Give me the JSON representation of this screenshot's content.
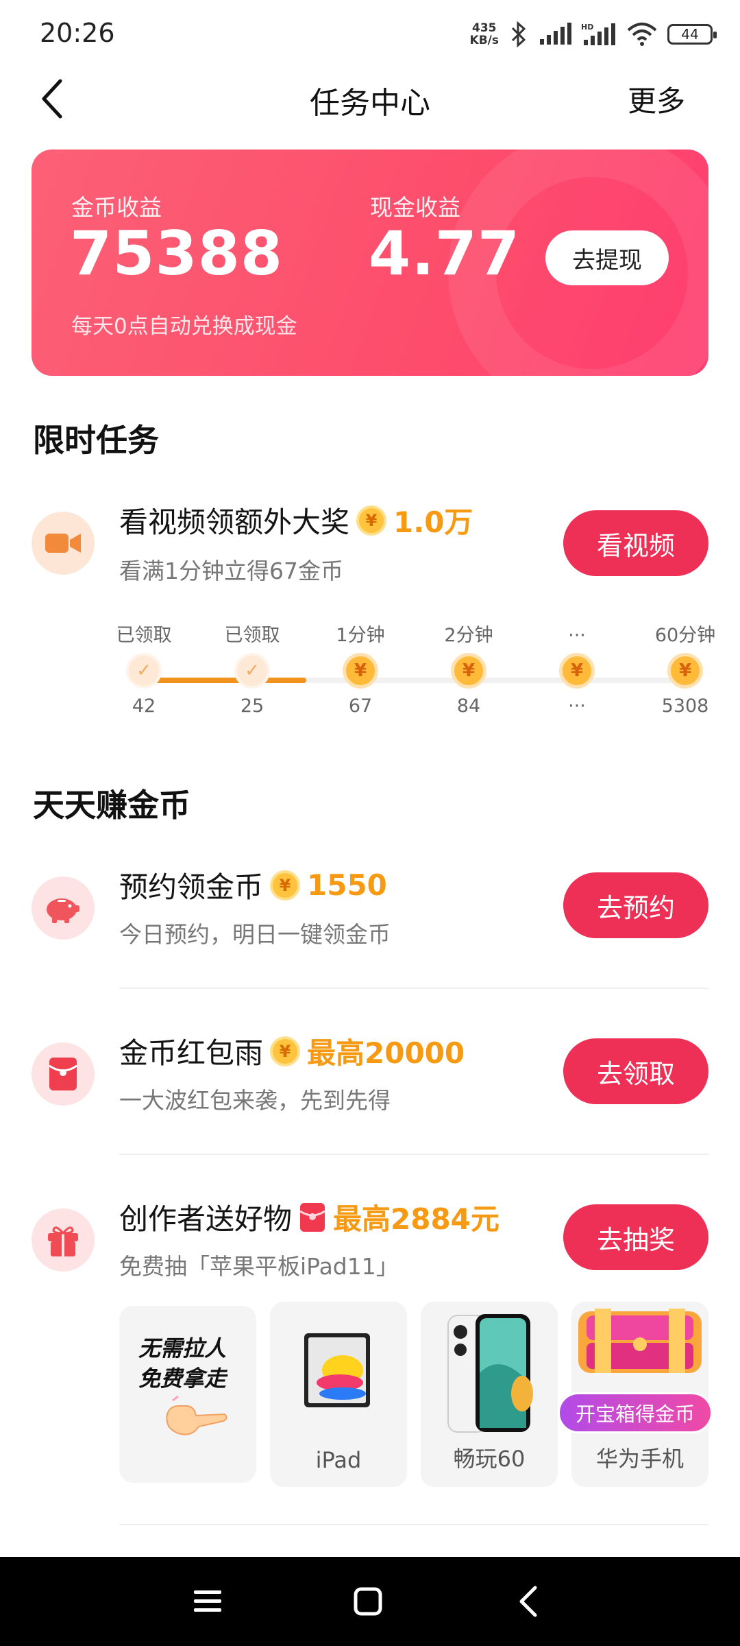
{
  "status_bar": {
    "time": "20:26",
    "net_speed_value": "435",
    "net_speed_unit": "KB/s",
    "battery": "44"
  },
  "header": {
    "title": "任务中心",
    "more": "更多"
  },
  "earnings": {
    "coin_label": "金币收益",
    "coin_value": "75388",
    "cash_label": "现金收益",
    "cash_value": "4.77",
    "note": "每天0点自动兑换成现金",
    "withdraw": "去提现"
  },
  "limited": {
    "section_title": "限时任务",
    "task": {
      "title": "看视频领额外大奖",
      "reward": "1.0万",
      "subtitle": "看满1分钟立得67金币",
      "button": "看视频",
      "icon": "video-camera-icon"
    },
    "progress": [
      {
        "label": "已领取",
        "value": "42",
        "state": "done"
      },
      {
        "label": "已领取",
        "value": "25",
        "state": "done"
      },
      {
        "label": "1分钟",
        "value": "67",
        "state": "coin"
      },
      {
        "label": "2分钟",
        "value": "84",
        "state": "coin"
      },
      {
        "label": "···",
        "value": "···",
        "state": "coin"
      },
      {
        "label": "60分钟",
        "value": "5308",
        "state": "coin"
      }
    ],
    "progress_fraction": 0.3
  },
  "daily": {
    "section_title": "天天赚金币",
    "tasks": [
      {
        "title": "预约领金币",
        "reward": "1550",
        "subtitle": "今日预约，明日一键领金币",
        "button": "去预约",
        "icon": "piggy-bank-icon"
      },
      {
        "title": "金币红包雨",
        "reward": "最高20000",
        "subtitle": "一大波红包来袭，先到先得",
        "button": "去领取",
        "icon": "red-envelope-icon"
      },
      {
        "title": "创作者送好物",
        "reward": "最高2884元",
        "subtitle": "免费抽「苹果平板iPad11」",
        "button": "去抽奖",
        "icon": "gift-icon"
      }
    ],
    "products": [
      {
        "label": "",
        "promo_line1": "无需拉人",
        "promo_line2": "免费拿走"
      },
      {
        "label": "iPad"
      },
      {
        "label": "畅玩60"
      },
      {
        "label": "华为手机"
      }
    ],
    "chest_badge": "开宝箱得金币"
  },
  "coin_symbol": "¥",
  "colors": {
    "accent": "#ee2f56",
    "reward": "#f59a12",
    "card_start": "#fc6076",
    "card_end": "#fe3e70"
  }
}
